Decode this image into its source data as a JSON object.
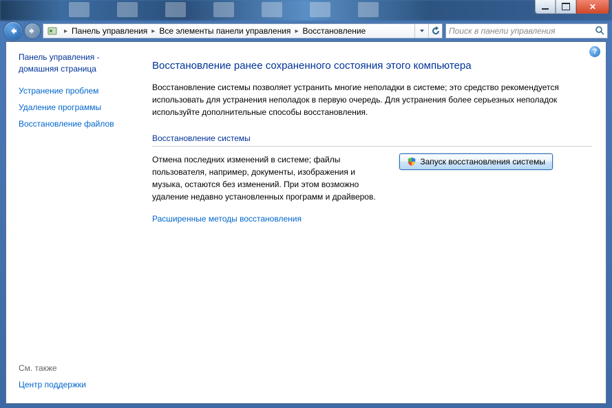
{
  "breadcrumb": {
    "b1": "Панель управления",
    "b2": "Все элементы панели управления",
    "b3": "Восстановление"
  },
  "search": {
    "placeholder": "Поиск в панели управления"
  },
  "sidebar": {
    "home": "Панель управления - домашняя страница",
    "link1": "Устранение проблем",
    "link2": "Удаление программы",
    "link3": "Восстановление файлов",
    "also_label": "См. также",
    "also_link": "Центр поддержки"
  },
  "content": {
    "title": "Восстановление ранее сохраненного состояния этого компьютера",
    "desc": "Восстановление системы позволяет устранить многие неполадки в системе; это средство рекомендуется использовать для устранения неполадок в первую очередь. Для устранения более серьезных неполадок используйте дополнительные способы восстановления.",
    "section_head": "Восстановление системы",
    "section_text": "Отмена последних изменений в системе; файлы пользователя, например, документы, изображения и музыка, остаются без изменений. При этом возможно удаление недавно установленных программ и драйверов.",
    "button": "Запуск восстановления системы",
    "adv_link": "Расширенные методы восстановления"
  }
}
